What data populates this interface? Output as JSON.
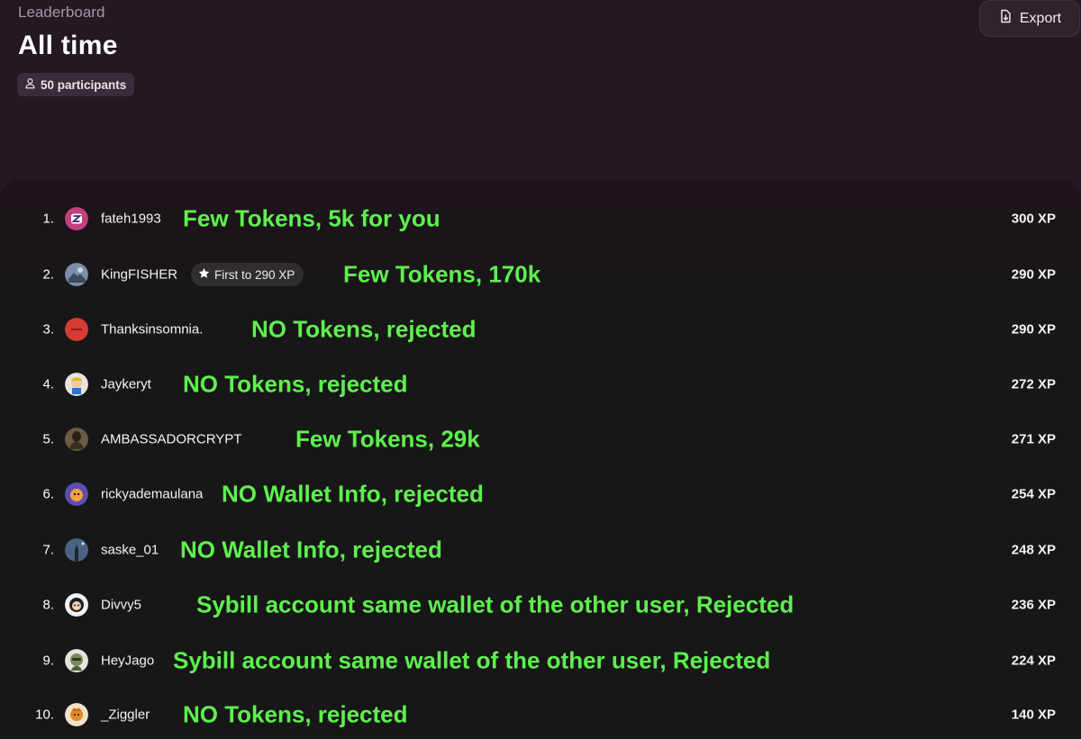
{
  "header": {
    "breadcrumb": "Leaderboard",
    "title": "All time",
    "participants": "50 participants",
    "export_label": "Export"
  },
  "rows": [
    {
      "rank": "1.",
      "username": "fateh1993",
      "note": "Few Tokens, 5k for you",
      "xp": "300 XP"
    },
    {
      "rank": "2.",
      "username": "KingFISHER",
      "badge": "First to 290 XP",
      "note": "Few Tokens, 170k",
      "xp": "290 XP"
    },
    {
      "rank": "3.",
      "username": "Thanksinsomnia.",
      "note": "NO Tokens, rejected",
      "xp": "290 XP"
    },
    {
      "rank": "4.",
      "username": "Jaykeryt",
      "note": "NO Tokens, rejected",
      "xp": "272 XP"
    },
    {
      "rank": "5.",
      "username": "AMBASSADORCRYPT",
      "note": "Few Tokens, 29k",
      "xp": "271 XP"
    },
    {
      "rank": "6.",
      "username": "rickyademaulana",
      "note": "NO Wallet Info, rejected",
      "xp": "254 XP"
    },
    {
      "rank": "7.",
      "username": "saske_01",
      "note": "NO Wallet Info, rejected",
      "xp": "248 XP"
    },
    {
      "rank": "8.",
      "username": "Divvy5",
      "note": "Sybill account same wallet of the other user, Rejected",
      "xp": "236 XP"
    },
    {
      "rank": "9.",
      "username": "HeyJago",
      "note": "Sybill account same wallet of the other user, Rejected",
      "xp": "224 XP"
    },
    {
      "rank": "10.",
      "username": "_Ziggler",
      "note": "NO Tokens, rejected",
      "xp": "140 XP"
    }
  ],
  "colors": {
    "background": "#251824",
    "panel": "#171717",
    "annotation_green": "#5ef04f"
  },
  "icons": {
    "participants": "user-icon",
    "export": "export-file-icon",
    "badge": "star-badge-icon"
  }
}
